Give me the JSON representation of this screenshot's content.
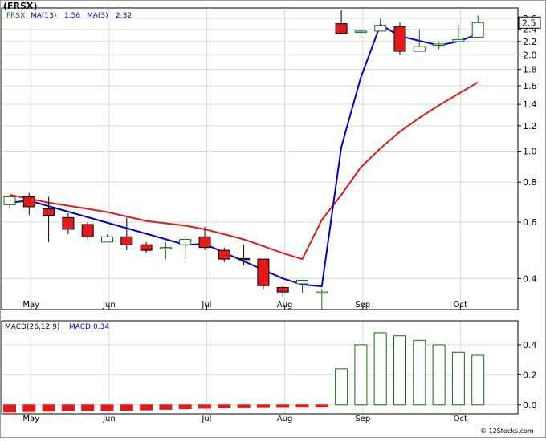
{
  "header": {
    "ticker_title": "(FRSX)",
    "legend_symbol": "FRSX",
    "legend_ma13": "MA(13)",
    "legend_ma13_value": "1.56",
    "legend_ma3": "MA(3)",
    "legend_ma3_value": "2.32",
    "macd_label": "MACD(26,12,9)",
    "macd_value_label": "MACD:0.34",
    "watermark": "© 12Stocks.com",
    "last_price_badge": "2.5"
  },
  "colors": {
    "up_candle": "#1a6b1a",
    "down_candle": "#e41a1a",
    "ma13": "#e41a1a",
    "ma3": "#0000cc",
    "macd_up": "#1a6b1a",
    "macd_down": "#e41a1a",
    "grid": "#d9d9d9",
    "legend_text": "#0000cc"
  },
  "chart_data": [
    {
      "type": "candlestick",
      "title": "FRSX",
      "scale": "log",
      "ylim": [
        0.32,
        2.8
      ],
      "grid": true,
      "legend": "top-left",
      "y_ticks": [
        "2.6",
        "2.4",
        "2.2",
        "2.0",
        "1.8",
        "1.6",
        "1.4",
        "1.2",
        "1.0",
        "0.8",
        "0.6",
        "0.4"
      ],
      "y_tick_values": [
        2.6,
        2.4,
        2.2,
        2.0,
        1.8,
        1.6,
        1.4,
        1.2,
        1.0,
        0.8,
        0.6,
        0.4
      ],
      "x_ticks": [
        "May",
        "Jun",
        "Jul",
        "Aug",
        "Sep",
        "Oct"
      ],
      "x_tick_index": [
        1.1,
        5.1,
        10.1,
        14.1,
        18.1,
        23.1
      ],
      "candles": [
        {
          "o": 0.68,
          "h": 0.72,
          "l": 0.66,
          "c": 0.72
        },
        {
          "o": 0.72,
          "h": 0.74,
          "l": 0.63,
          "c": 0.67
        },
        {
          "o": 0.66,
          "h": 0.72,
          "l": 0.52,
          "c": 0.63
        },
        {
          "o": 0.62,
          "h": 0.64,
          "l": 0.55,
          "c": 0.57
        },
        {
          "o": 0.59,
          "h": 0.6,
          "l": 0.53,
          "c": 0.54
        },
        {
          "o": 0.52,
          "h": 0.55,
          "l": 0.52,
          "c": 0.54
        },
        {
          "o": 0.54,
          "h": 0.62,
          "l": 0.49,
          "c": 0.51
        },
        {
          "o": 0.51,
          "h": 0.52,
          "l": 0.48,
          "c": 0.49
        },
        {
          "o": 0.5,
          "h": 0.52,
          "l": 0.46,
          "c": 0.5
        },
        {
          "o": 0.51,
          "h": 0.54,
          "l": 0.46,
          "c": 0.53
        },
        {
          "o": 0.54,
          "h": 0.58,
          "l": 0.49,
          "c": 0.5
        },
        {
          "o": 0.49,
          "h": 0.5,
          "l": 0.45,
          "c": 0.46
        },
        {
          "o": 0.462,
          "h": 0.51,
          "l": 0.44,
          "c": 0.458
        },
        {
          "o": 0.46,
          "h": 0.46,
          "l": 0.37,
          "c": 0.38
        },
        {
          "o": 0.375,
          "h": 0.38,
          "l": 0.35,
          "c": 0.363
        },
        {
          "o": 0.385,
          "h": 0.395,
          "l": 0.36,
          "c": 0.395
        },
        {
          "o": 0.36,
          "h": 0.37,
          "l": 0.32,
          "c": 0.363
        },
        {
          "o": 2.5,
          "h": 2.75,
          "l": 2.32,
          "c": 2.33
        },
        {
          "o": 2.37,
          "h": 2.42,
          "l": 2.27,
          "c": 2.37
        },
        {
          "o": 2.37,
          "h": 2.6,
          "l": 2.37,
          "c": 2.47
        },
        {
          "o": 2.45,
          "h": 2.52,
          "l": 2.0,
          "c": 2.05
        },
        {
          "o": 2.05,
          "h": 2.4,
          "l": 2.05,
          "c": 2.12
        },
        {
          "o": 2.15,
          "h": 2.19,
          "l": 2.08,
          "c": 2.16
        },
        {
          "o": 2.2,
          "h": 2.48,
          "l": 2.18,
          "c": 2.23
        },
        {
          "o": 2.27,
          "h": 2.65,
          "l": 2.25,
          "c": 2.52
        }
      ],
      "series": [
        {
          "name": "MA(13)",
          "x": [
            0,
            1,
            2,
            3,
            4,
            5,
            6,
            7,
            8,
            9,
            10,
            11,
            12,
            13,
            14,
            15,
            16,
            17,
            18,
            19,
            20,
            21,
            22,
            23,
            24
          ],
          "values": [
            0.73,
            0.71,
            0.69,
            0.675,
            0.66,
            0.645,
            0.625,
            0.605,
            0.595,
            0.585,
            0.57,
            0.55,
            0.53,
            0.505,
            0.48,
            0.46,
            0.61,
            0.73,
            0.89,
            1.02,
            1.15,
            1.27,
            1.39,
            1.51,
            1.64
          ]
        },
        {
          "name": "MA(3)",
          "x": [
            0,
            1,
            9,
            10,
            14,
            15,
            16,
            17,
            18,
            19,
            20,
            21,
            22,
            23,
            24
          ],
          "values": [
            0.69,
            0.7,
            0.51,
            0.513,
            0.4,
            0.383,
            0.378,
            1.03,
            1.7,
            2.48,
            2.29,
            2.21,
            2.14,
            2.2,
            2.32
          ]
        }
      ]
    },
    {
      "type": "bar",
      "title": "MACD(26,12,9)",
      "ylim": [
        -0.06,
        0.56
      ],
      "y_ticks": [
        "0.4",
        "0.2",
        "0.0"
      ],
      "y_tick_values": [
        0.4,
        0.2,
        0.0
      ],
      "x_ticks": [
        "May",
        "Jun",
        "Jul",
        "Aug",
        "Sep",
        "Oct"
      ],
      "x_tick_index": [
        1.1,
        5.1,
        10.1,
        14.1,
        18.1,
        23.1
      ],
      "values": [
        -0.048,
        -0.045,
        -0.042,
        -0.04,
        -0.039,
        -0.038,
        -0.036,
        -0.034,
        -0.03,
        -0.026,
        -0.022,
        -0.02,
        -0.019,
        -0.018,
        -0.017,
        -0.016,
        -0.015,
        0.24,
        0.4,
        0.48,
        0.46,
        0.43,
        0.4,
        0.35,
        0.33
      ]
    }
  ]
}
